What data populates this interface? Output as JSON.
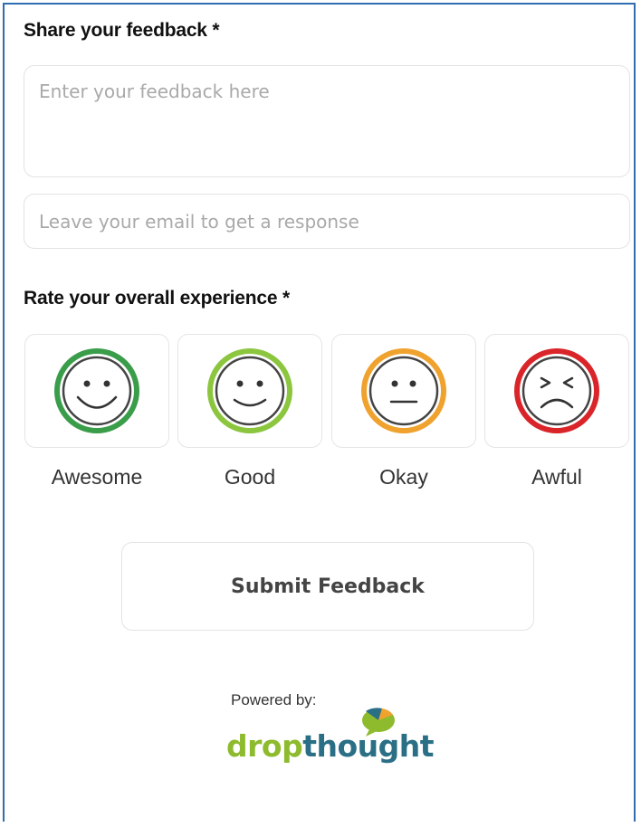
{
  "feedback": {
    "heading": "Share your feedback *",
    "feedback_placeholder": "Enter your feedback here",
    "email_placeholder": "Leave your email to get a response"
  },
  "rating": {
    "heading": "Rate your overall experience *",
    "options": [
      {
        "label": "Awesome",
        "ring_color": "#3a9d4a",
        "icon": "big-smile-face-icon"
      },
      {
        "label": "Good",
        "ring_color": "#8cc63f",
        "icon": "smile-face-icon"
      },
      {
        "label": "Okay",
        "ring_color": "#f0a22e",
        "icon": "neutral-face-icon"
      },
      {
        "label": "Awful",
        "ring_color": "#d9252a",
        "icon": "frown-face-icon"
      }
    ]
  },
  "submit_label": "Submit Feedback",
  "footer": {
    "powered_by": "Powered by:",
    "brand_part1": "drop",
    "brand_part2": "thought",
    "brand_colors": {
      "drop": "#8dbb2d",
      "thought": "#2a6f86"
    }
  }
}
